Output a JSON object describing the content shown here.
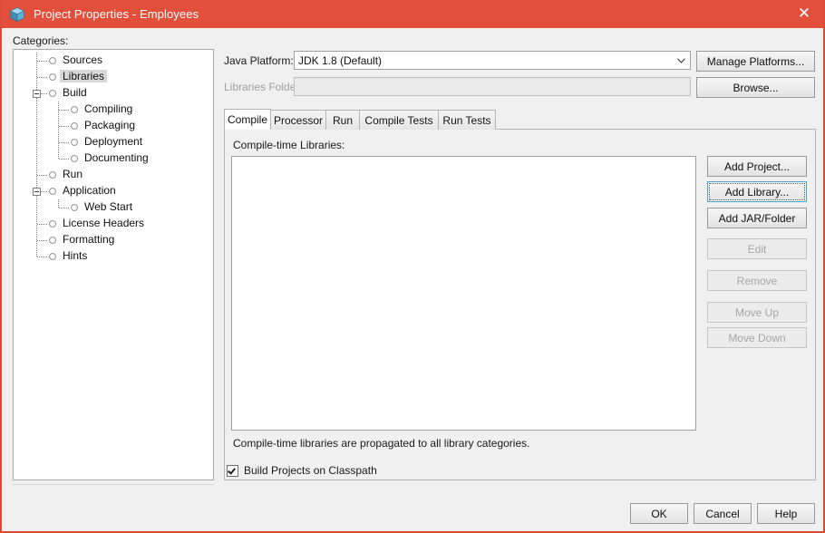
{
  "window": {
    "title": "Project Properties - Employees",
    "icon": "cube-icon",
    "close_label": "✕",
    "accent_color": "#e2503c",
    "background_color": "#f0f0f0"
  },
  "sidebar": {
    "label": "Categories:",
    "items": [
      {
        "label": "Sources",
        "depth": 0,
        "expander": "",
        "selected": false
      },
      {
        "label": "Libraries",
        "depth": 0,
        "expander": "",
        "selected": true
      },
      {
        "label": "Build",
        "depth": 0,
        "expander": "minus",
        "selected": false
      },
      {
        "label": "Compiling",
        "depth": 1,
        "expander": "",
        "selected": false
      },
      {
        "label": "Packaging",
        "depth": 1,
        "expander": "",
        "selected": false
      },
      {
        "label": "Deployment",
        "depth": 1,
        "expander": "",
        "selected": false
      },
      {
        "label": "Documenting",
        "depth": 1,
        "expander": "",
        "selected": false
      },
      {
        "label": "Run",
        "depth": 0,
        "expander": "",
        "selected": false
      },
      {
        "label": "Application",
        "depth": 0,
        "expander": "minus",
        "selected": false
      },
      {
        "label": "Web Start",
        "depth": 1,
        "expander": "",
        "selected": false
      },
      {
        "label": "License Headers",
        "depth": 0,
        "expander": "",
        "selected": false
      },
      {
        "label": "Formatting",
        "depth": 0,
        "expander": "",
        "selected": false
      },
      {
        "label": "Hints",
        "depth": 0,
        "expander": "",
        "selected": false
      }
    ]
  },
  "form": {
    "java_platform_label": "Java Platform:",
    "java_platform_value": "JDK 1.8 (Default)",
    "java_platform_options": [
      "JDK 1.8 (Default)"
    ],
    "manage_platforms_label": "Manage Platforms...",
    "libraries_folder_label": "Libraries Folder:",
    "libraries_folder_value": "",
    "libraries_folder_placeholder": "",
    "browse_label": "Browse..."
  },
  "tabs": [
    {
      "label": "Compile",
      "active": true
    },
    {
      "label": "Processor",
      "active": false
    },
    {
      "label": "Run",
      "active": false
    },
    {
      "label": "Compile Tests",
      "active": false
    },
    {
      "label": "Run Tests",
      "active": false
    }
  ],
  "main": {
    "list_label": "Compile-time Libraries:",
    "list_items": [],
    "hint": "Compile-time libraries are propagated to all library categories.",
    "checkbox_label": "Build Projects on Classpath",
    "checkbox_checked": true
  },
  "side_buttons": [
    {
      "label": "Add Project...",
      "enabled": true,
      "focused": false
    },
    {
      "label": "Add Library...",
      "enabled": true,
      "focused": true
    },
    {
      "label": "Add JAR/Folder",
      "enabled": true,
      "focused": false
    },
    {
      "label": "Edit",
      "enabled": false,
      "focused": false
    },
    {
      "label": "Remove",
      "enabled": false,
      "focused": false
    },
    {
      "label": "Move Up",
      "enabled": false,
      "focused": false
    },
    {
      "label": "Move Down",
      "enabled": false,
      "focused": false
    }
  ],
  "footer": {
    "ok_label": "OK",
    "cancel_label": "Cancel",
    "help_label": "Help"
  }
}
